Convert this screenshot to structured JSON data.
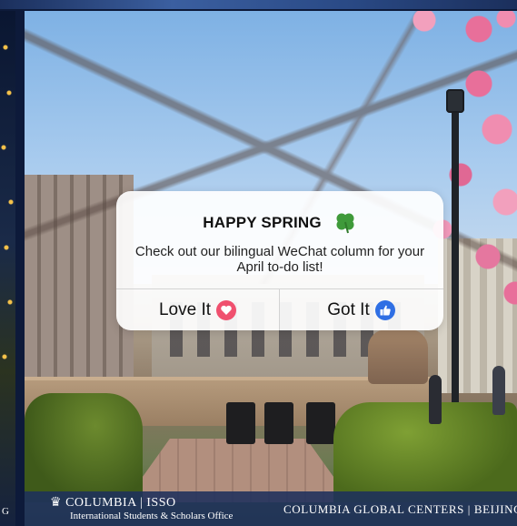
{
  "popup": {
    "title": "HAPPY SPRING",
    "title_icon": "four-leaf-clover-icon",
    "body": "Check out our bilingual WeChat column for your April to-do list!",
    "buttons": [
      {
        "label": "Love It",
        "icon": "heart-reaction-icon",
        "color": "#f0506e"
      },
      {
        "label": "Got It",
        "icon": "thumbs-up-reaction-icon",
        "color": "#2f6fe4"
      }
    ]
  },
  "banner": {
    "left_logo": "COLUMBIA | ISSO",
    "left_subtitle": "International Students & Scholars Office",
    "right_text": "COLUMBIA GLOBAL CENTERS | BEIJING"
  },
  "prev_slide": {
    "caption": "G"
  },
  "colors": {
    "banner_bg": "#1e305c",
    "accent_clover": "#3f9a3a"
  }
}
